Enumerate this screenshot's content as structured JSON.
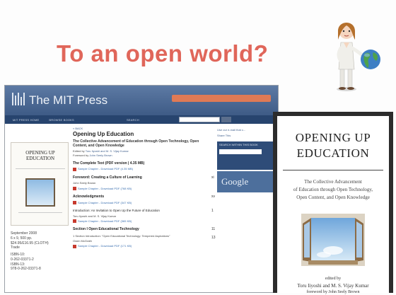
{
  "slide": {
    "title": "To an open world?"
  },
  "mitpress": {
    "site_name": "The MIT Press",
    "nav_items": [
      "MIT PRESS HOME",
      "BROWSE BOOKS",
      "SEARCH"
    ],
    "back_link": "« BACK",
    "book_title": "Opening Up Education",
    "book_subtitle": "The Collective Advancement of Education through Open Technology, Open Content, and Open Knowledge",
    "edited_by_label": "Edited by",
    "editors": "Toru Iiyoshi and M. S. Vijay Kumar",
    "foreword_label": "Foreword by",
    "foreword_author": "John Seely Brown",
    "complete_text": "The Complete Text (PDF version | 4.35 MB)",
    "sections": [
      {
        "title": "",
        "author": "",
        "download": "Sample Chapter - Download PDF (4.35 MB)",
        "page": ""
      },
      {
        "title": "Foreword: Creating a Culture of Learning",
        "author": "John Seely Brown",
        "download": "Sample Chapter - Download PDF (768 KB)",
        "page": "xi"
      },
      {
        "title": "Acknowledgments",
        "author": "",
        "download": "Sample Chapter - Download PDF (347 KB)",
        "page": "xv"
      },
      {
        "title": "Introduction: An Invitation to Open Up the Future of Education",
        "author": "Toru Iiyoshi and M. S. Vijay Kumar",
        "download": "Sample Chapter - Download PDF (365 KB)",
        "page": "1"
      },
      {
        "title": "Section I Open Educational Technology",
        "author": "",
        "download": "",
        "page": "11"
      },
      {
        "title": "1  Section Introduction: \"Open Educational Technology: Tempered Aspirations\"",
        "author": "Owen McGrath",
        "download": "Sample Chapter - Download PDF (171 KB)",
        "page": "13"
      }
    ],
    "meta": {
      "date": "September 2008",
      "size": "6 x 9, 500 pp.",
      "price": "$24.95/£16.95 (CLOTH)",
      "type": "Trade",
      "isbn10_label": "ISBN-10:",
      "isbn10": "0-262-03371-2",
      "isbn13_label": "ISBN-13:",
      "isbn13": "978-0-262-03371-8"
    },
    "sidebar": {
      "email_link": "Use our e-mail that c...",
      "share_label": "Share This",
      "search_label": "SEARCH WITHIN THIS BOOK",
      "google_label": "Google"
    }
  },
  "cover": {
    "title_line1": "OPENING UP",
    "title_line2": "EDUCATION",
    "subtitle_line1": "The Collective Advancement",
    "subtitle_line2": "of Education through Open Technology,",
    "subtitle_line3": "Open Content, and Open Knowledge",
    "edited_by": "edited by",
    "editors": "Toru Iiyoshi and M. S. Vijay Kumar",
    "foreword": "foreword by John Seely Brown"
  },
  "colors": {
    "title_red": "#e0665a",
    "mit_blue": "#3e5b86",
    "mit_nav": "#27446e",
    "link_blue": "#3a6fb0"
  }
}
